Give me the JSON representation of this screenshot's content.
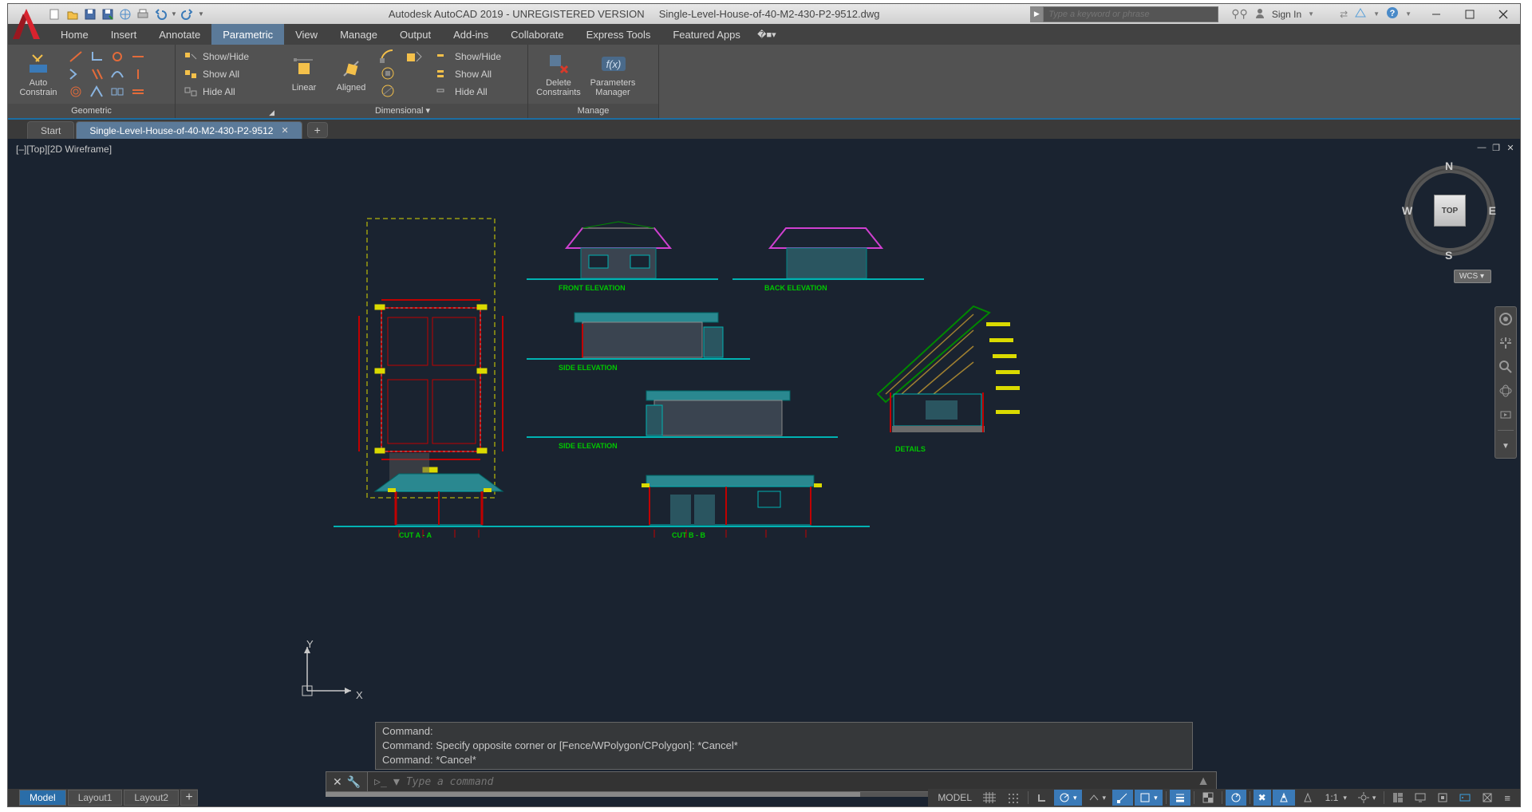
{
  "title": {
    "app": "Autodesk AutoCAD 2019 - UNREGISTERED VERSION",
    "file": "Single-Level-House-of-40-M2-430-P2-9512.dwg"
  },
  "search": {
    "placeholder": "Type a keyword or phrase"
  },
  "signin": {
    "label": "Sign In"
  },
  "menus": [
    "Home",
    "Insert",
    "Annotate",
    "Parametric",
    "View",
    "Manage",
    "Output",
    "Add-ins",
    "Collaborate",
    "Express Tools",
    "Featured Apps"
  ],
  "menus_active": 3,
  "ribbon": {
    "geometric": {
      "title": "Geometric",
      "auto": "Auto\nConstrain",
      "show": "Show/Hide",
      "all": "Show All",
      "hide": "Hide All"
    },
    "dimensional": {
      "title": "Dimensional ▾",
      "linear": "Linear",
      "aligned": "Aligned",
      "show": "Show/Hide",
      "all": "Show All",
      "hide": "Hide All"
    },
    "manage": {
      "title": "Manage",
      "delete": "Delete\nConstraints",
      "params": "Parameters\nManager"
    }
  },
  "filetabs": {
    "start": "Start",
    "doc": "Single-Level-House-of-40-M2-430-P2-9512"
  },
  "viewport": {
    "label": "[–][Top][2D Wireframe]",
    "cube": "TOP",
    "compass": {
      "n": "N",
      "s": "S",
      "e": "E",
      "w": "W"
    },
    "wcs": "WCS ▾"
  },
  "drawing_labels": {
    "front": "FRONT ELEVATION",
    "back": "BACK ELEVATION",
    "side1": "SIDE ELEVATION",
    "side2": "SIDE ELEVATION",
    "cuta": "CUT  A - A",
    "cutb": "CUT  B - B",
    "details": "DETAILS"
  },
  "ucs": {
    "x": "X",
    "y": "Y"
  },
  "cmd": {
    "l1": "Command:",
    "l2": "Command: Specify opposite corner or [Fence/WPolygon/CPolygon]: *Cancel*",
    "l3": "Command: *Cancel*",
    "placeholder": "Type a command"
  },
  "layouts": [
    "Model",
    "Layout1",
    "Layout2"
  ],
  "status": {
    "model": "MODEL",
    "scale": "1:1"
  }
}
